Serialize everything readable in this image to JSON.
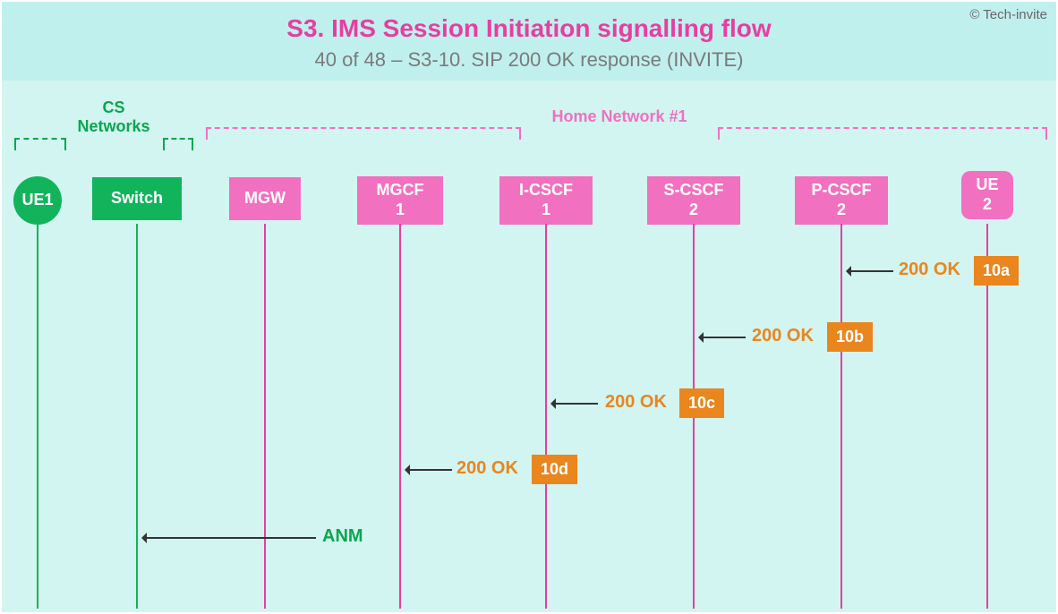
{
  "copyright": "© Tech-invite",
  "title": "S3. IMS Session Initiation signalling flow",
  "subtitle": "40 of 48 – S3-10. SIP 200 OK response (INVITE)",
  "groups": {
    "cs": {
      "line1": "CS",
      "line2": "Networks"
    },
    "home": {
      "label": "Home Network #1"
    }
  },
  "nodes": {
    "ue1": "UE1",
    "switch": "Switch",
    "mgw": "MGW",
    "mgcf1_l1": "MGCF",
    "mgcf1_l2": "1",
    "icscf1_l1": "I-CSCF",
    "icscf1_l2": "1",
    "scscf2_l1": "S-CSCF",
    "scscf2_l2": "2",
    "pcscf2_l1": "P-CSCF",
    "pcscf2_l2": "2",
    "ue2_l1": "UE",
    "ue2_l2": "2"
  },
  "messages": {
    "m10a": {
      "badge": "10a",
      "text": "200 OK"
    },
    "m10b": {
      "badge": "10b",
      "text": "200 OK"
    },
    "m10c": {
      "badge": "10c",
      "text": "200 OK"
    },
    "m10d": {
      "badge": "10d",
      "text": "200 OK"
    },
    "anm": {
      "text": "ANM"
    }
  }
}
